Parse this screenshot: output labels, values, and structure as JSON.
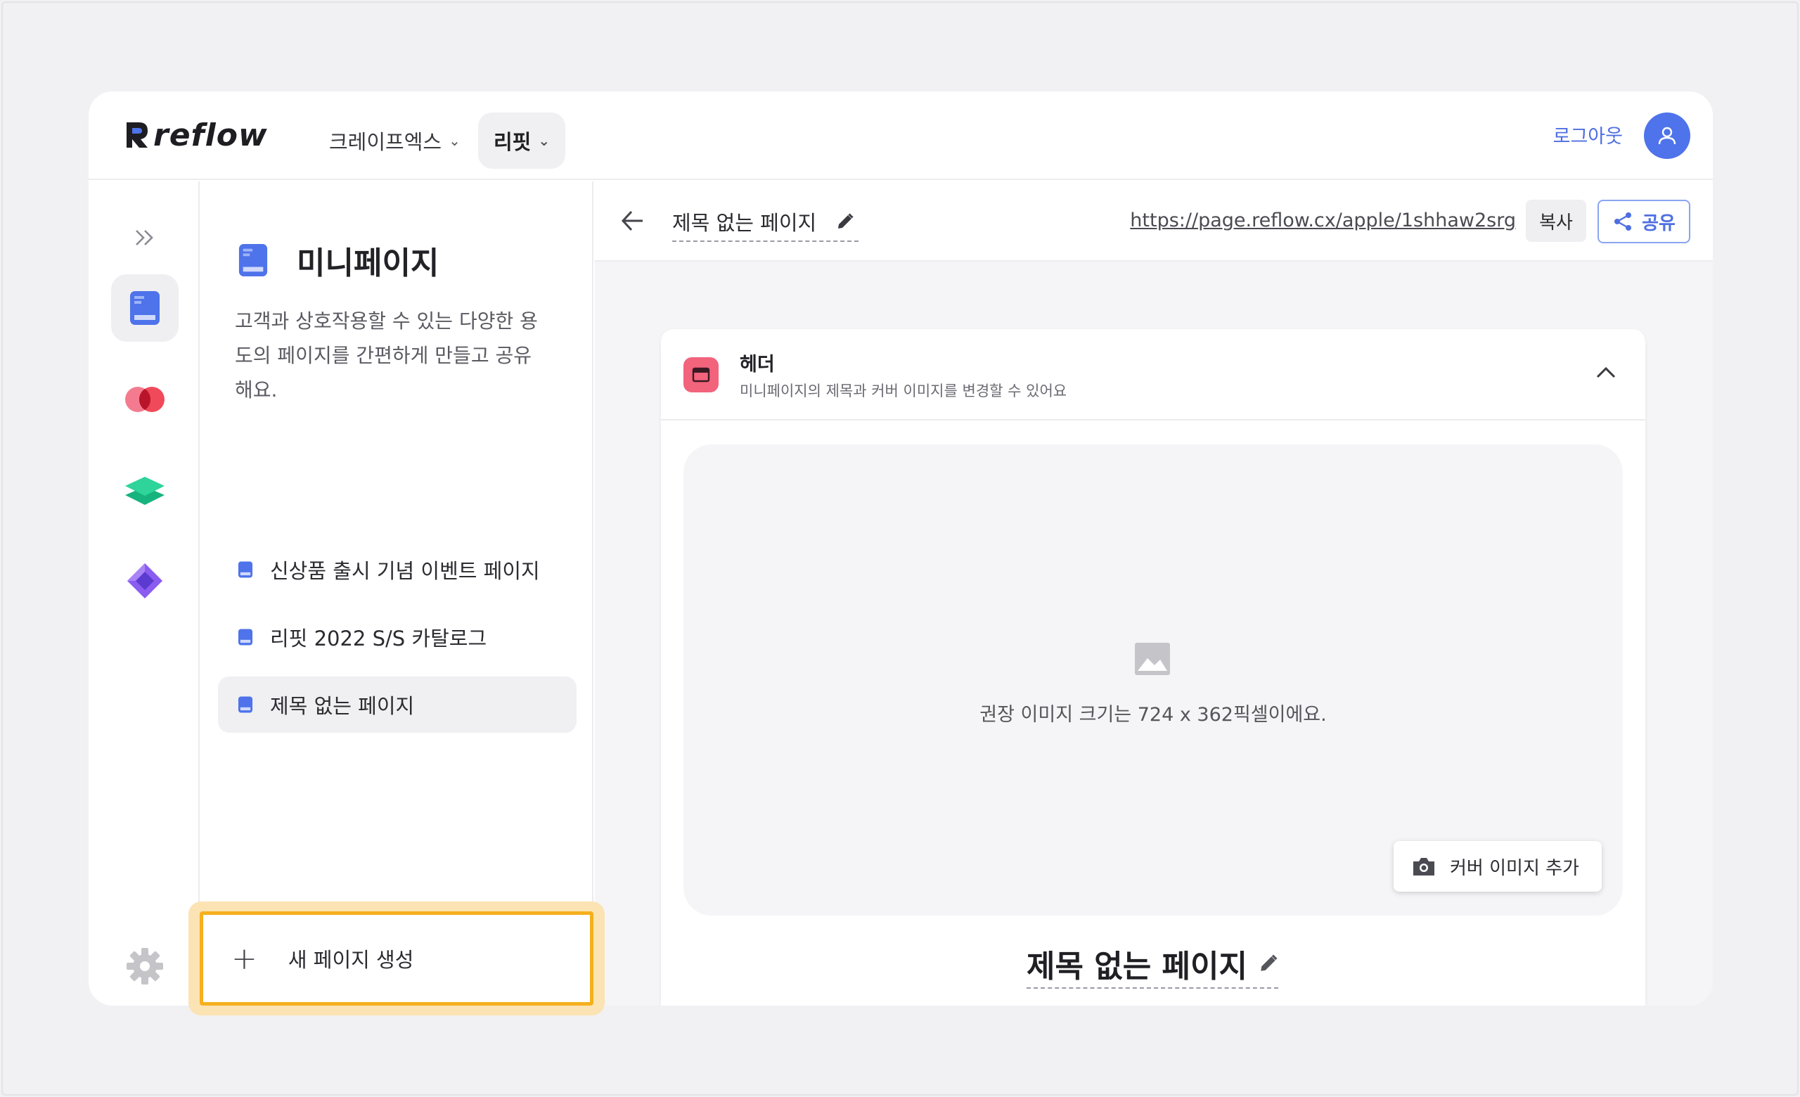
{
  "brand": {
    "logo_text": "reflow"
  },
  "topbar": {
    "workspace": "크레이프엑스",
    "brand_switch": "리핏",
    "logout_label": "로그아웃"
  },
  "panel": {
    "title": "미니페이지",
    "description": "고객과 상호작용할 수 있는 다양한 용도의 페이지를 간편하게 만들고 공유해요.",
    "items": [
      {
        "label": "신상품 출시 기념 이벤트 페이지"
      },
      {
        "label": "리핏 2022 S/S 카탈로그"
      },
      {
        "label": "제목 없는 페이지"
      }
    ],
    "new_page_label": "새 페이지 생성"
  },
  "editor": {
    "page_name": "제목 없는 페이지",
    "url": "https://page.reflow.cx/apple/1shhaw2srg",
    "copy_label": "복사",
    "share_label": "공유",
    "header_card": {
      "title": "헤더",
      "subtitle": "미니페이지의 제목과 커버 이미지를 변경할 수 있어요",
      "cover_hint": "권장 이미지 크기는 724 x 362픽셀이에요.",
      "add_cover_label": "커버 이미지 추가",
      "page_heading": "제목 없는 페이지"
    }
  },
  "colors": {
    "accent_blue": "#4e73ea",
    "highlight_orange": "#f5b01e",
    "header_icon_pink": "#f2637c"
  },
  "icons": {
    "rail": [
      "expand-icon",
      "minipage-icon",
      "circles-icon",
      "layers-icon",
      "diamond-icon",
      "gear-icon"
    ]
  }
}
